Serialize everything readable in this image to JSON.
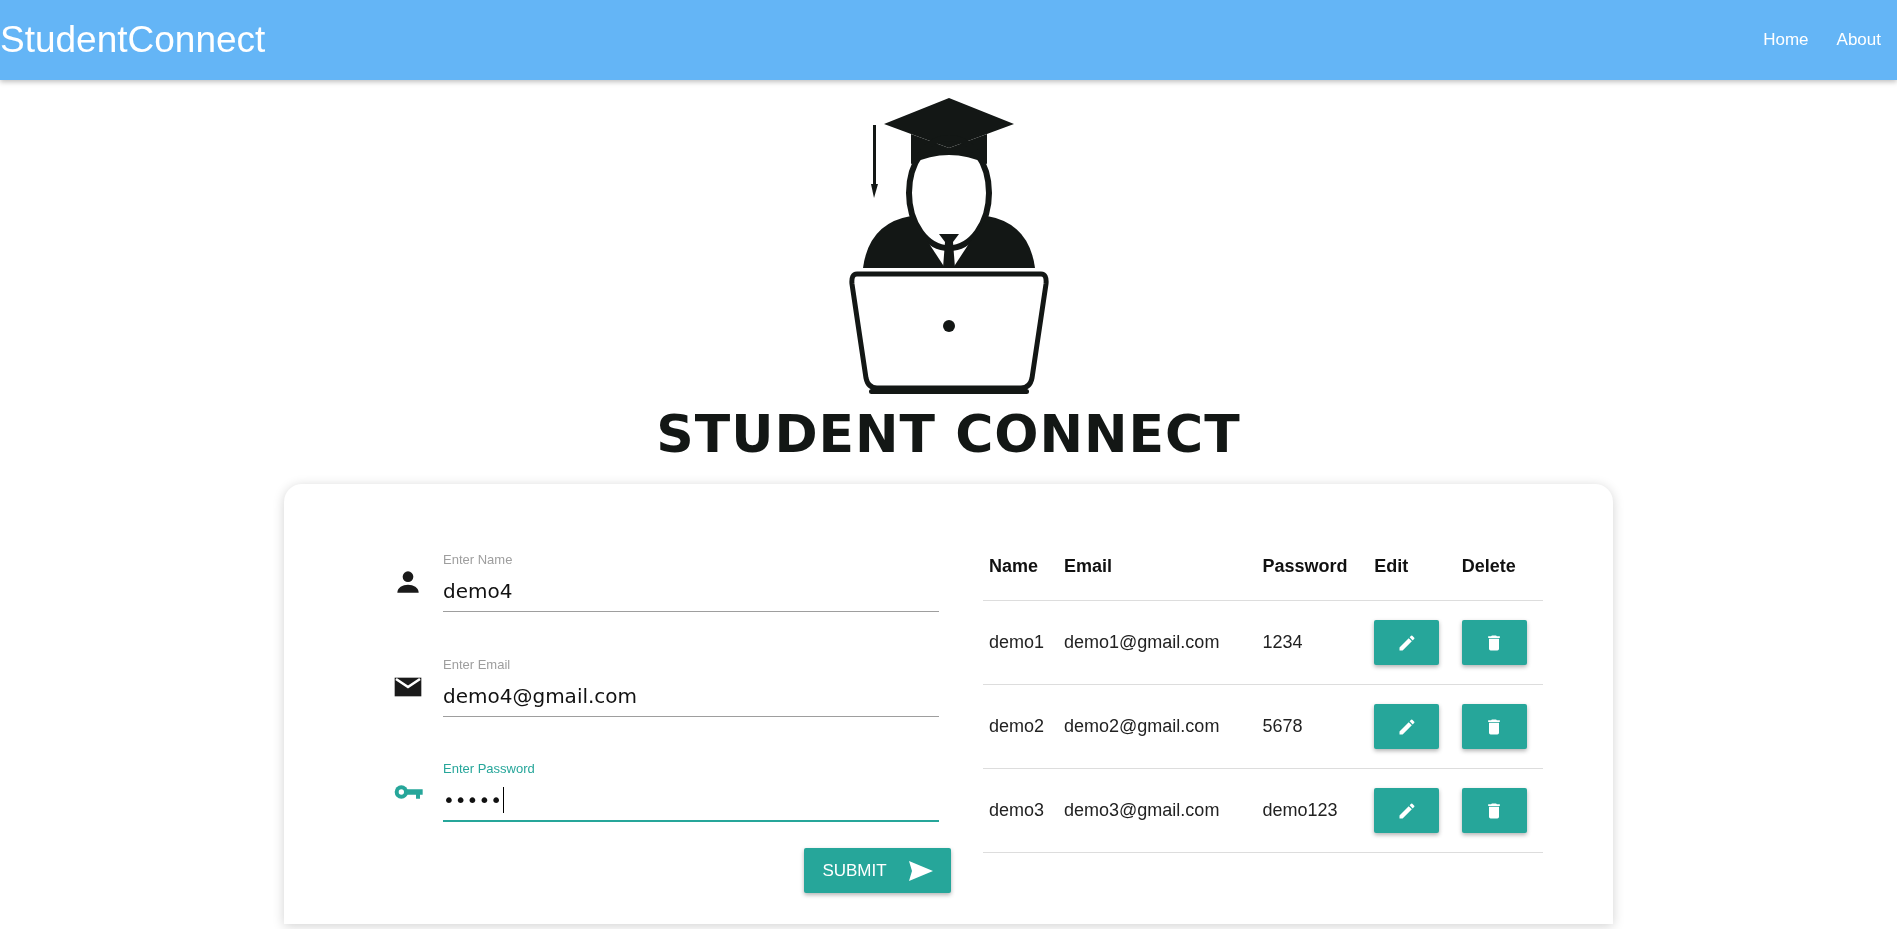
{
  "navbar": {
    "brand": "StudentConnect",
    "links": [
      "Home",
      "About"
    ]
  },
  "logo": {
    "text": "STUDENT CONNECT"
  },
  "form": {
    "fields": [
      {
        "kind": "person",
        "label": "Enter Name",
        "value": "demo4",
        "focused": false
      },
      {
        "kind": "email",
        "label": "Enter Email",
        "value": "demo4@gmail.com",
        "focused": false
      },
      {
        "kind": "key",
        "label": "Enter Password",
        "value": "•••••",
        "focused": true
      }
    ],
    "submit": "SUBMIT"
  },
  "table": {
    "columns": [
      "Name",
      "Email",
      "Password",
      "Edit",
      "Delete"
    ],
    "rows": [
      {
        "name": "demo1",
        "email": "demo1@gmail.com",
        "password": "1234"
      },
      {
        "name": "demo2",
        "email": "demo2@gmail.com",
        "password": "5678"
      },
      {
        "name": "demo3",
        "email": "demo3@gmail.com",
        "password": "demo123"
      }
    ]
  }
}
